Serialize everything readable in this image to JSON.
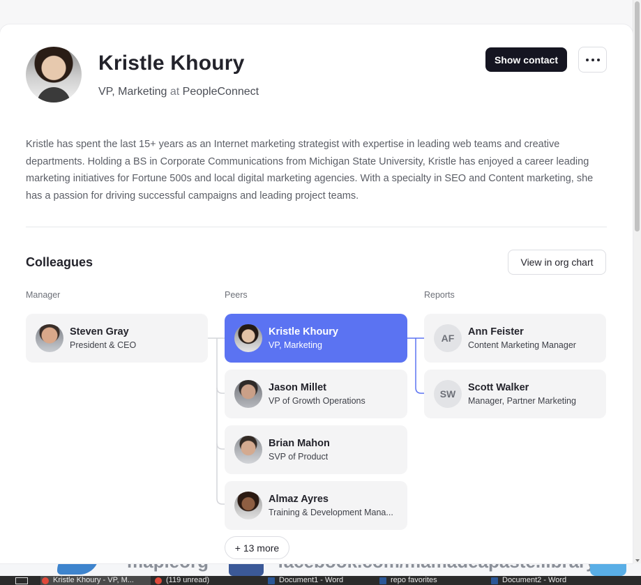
{
  "profile": {
    "name": "Kristle Khoury",
    "role": "VP, Marketing",
    "at": "at",
    "company": "PeopleConnect",
    "bio": "Kristle has spent the last 15+ years as an Internet marketing strategist with expertise in leading web teams and creative departments. Holding a BS in Corporate Communications from Michigan State University, Kristle has enjoyed a career leading marketing initiatives for Fortune 500s and local digital marketing agencies. With a specialty in SEO and Content marketing, she has a passion for driving successful campaigns and leading project teams."
  },
  "actions": {
    "show_contact": "Show contact",
    "more_icon": "more-horizontal-icon"
  },
  "colleagues": {
    "heading": "Colleagues",
    "org_chart_button": "View in org chart",
    "manager_label": "Manager",
    "peers_label": "Peers",
    "reports_label": "Reports",
    "manager": {
      "name": "Steven Gray",
      "role": "President & CEO"
    },
    "peers": [
      {
        "name": "Kristle Khoury",
        "role": "VP, Marketing"
      },
      {
        "name": "Jason Millet",
        "role": "VP of Growth Operations"
      },
      {
        "name": "Brian Mahon",
        "role": "SVP of Product"
      },
      {
        "name": "Almaz Ayres",
        "role": "Training & Development Mana..."
      }
    ],
    "reports": [
      {
        "initials": "AF",
        "name": "Ann Feister",
        "role": "Content Marketing Manager"
      },
      {
        "initials": "SW",
        "name": "Scott Walker",
        "role": "Manager, Partner Marketing"
      }
    ],
    "more_peers": "+ 13 more"
  },
  "colors": {
    "accent": "#5b73f2",
    "primary_button": "#151521",
    "card_bg": "#f4f4f5",
    "connector": "#d4d5da"
  },
  "background": {
    "text_left": "mapleorg",
    "text_right": "facebook.com/mamadeapaste.library"
  },
  "taskbar": {
    "items": [
      "Kristle Khoury - VP, M...",
      "(119 unread)",
      "Document1 - Word",
      "repo favorites",
      "Document2 - Word"
    ]
  }
}
